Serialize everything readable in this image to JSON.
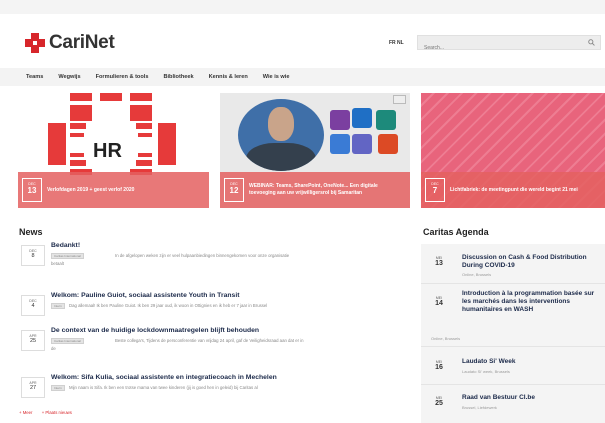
{
  "brand": {
    "name": "CariNet",
    "accent": "#d7262b"
  },
  "header": {
    "language": "FR NL",
    "search": {
      "placeholder": "Search..."
    }
  },
  "nav": {
    "items": [
      {
        "label": "Teams"
      },
      {
        "label": "Wegwijs"
      },
      {
        "label": "Formulieren & tools"
      },
      {
        "label": "Bibliotheek"
      },
      {
        "label": "Kennis & leren"
      },
      {
        "label": "Wie is wie"
      }
    ]
  },
  "carousel": {
    "slides": [
      {
        "image_text": "HR",
        "month": "DEC",
        "day": "13",
        "title": "Verlofdagen 2019 + geest verlof 2020"
      },
      {
        "month": "DEC",
        "day": "12",
        "title": "WEBINAR: Teams, SharePoint, OneNote... Een digitale toevoeging aan uw vrijwilligersrol bij Samaritan"
      },
      {
        "month": "DEC",
        "day": "7",
        "title": "Lichtfabriek: de meetingpunt die wereld begint 21 mei"
      }
    ]
  },
  "news": {
    "title": "News",
    "items": [
      {
        "month": "DEC",
        "day": "8",
        "title": "Bedankt!",
        "badge": "Caritas International",
        "snippet": "In de afgelopen weken zijn er veel hulpaanbiedingen binnengekomen voor onze organisatie",
        "snippet2": "betaalt"
      },
      {
        "month": "DEC",
        "day": "4",
        "title": "Welkom: Pauline Guiot, sociaal assistente Youth in Transit",
        "badge": "Intern",
        "snippet": "Dag allemaal! Ik ben Pauline Guiot. Ik ben 29 jaar oud, ik woon in Ottignies en ik heb er 7 jaar in Brussel",
        "snippet2": ""
      },
      {
        "month": "APR",
        "day": "25",
        "title": "De context van de huidige lockdownmaatregelen blijft behouden",
        "badge": "Caritas International",
        "snippet": "Beste collega's, Tijdens de persconferentie van vrijdag 24 april, gaf de Veiligheidsraad aan dat er in",
        "snippet2": "de"
      },
      {
        "month": "APR",
        "day": "27",
        "title": "Welkom: Sifa Kulia, sociaal assistente en integratiecoach in Mechelen",
        "badge": "Intern",
        "snippet": "Mijn naam is Sifa. Ik ben een trotse mama van twee kinderen (jij is goed hen in geleid) bij Caritas al",
        "snippet2": ""
      }
    ],
    "footer_links": [
      "+ Meer",
      "+ Plaats nieuws"
    ]
  },
  "agenda": {
    "title": "Caritas Agenda",
    "items": [
      {
        "month": "MEI",
        "day": "13",
        "title": "Discussion on Cash & Food Distribution During COVID-19",
        "location": "Online, Brussels"
      },
      {
        "month": "MEI",
        "day": "14",
        "title": "Introduction à la programmation basée sur les marchés dans les interventions humanitaires en WASH",
        "location": "Online, Brussels"
      },
      {
        "month": "MEI",
        "day": "16",
        "title": "Laudato Si' Week",
        "location": "Laudato Si' week, Brussels"
      },
      {
        "month": "MEI",
        "day": "25",
        "title": "Raad van Bestuur CI.be",
        "location": "Brussel, Liefdewerk"
      }
    ]
  }
}
